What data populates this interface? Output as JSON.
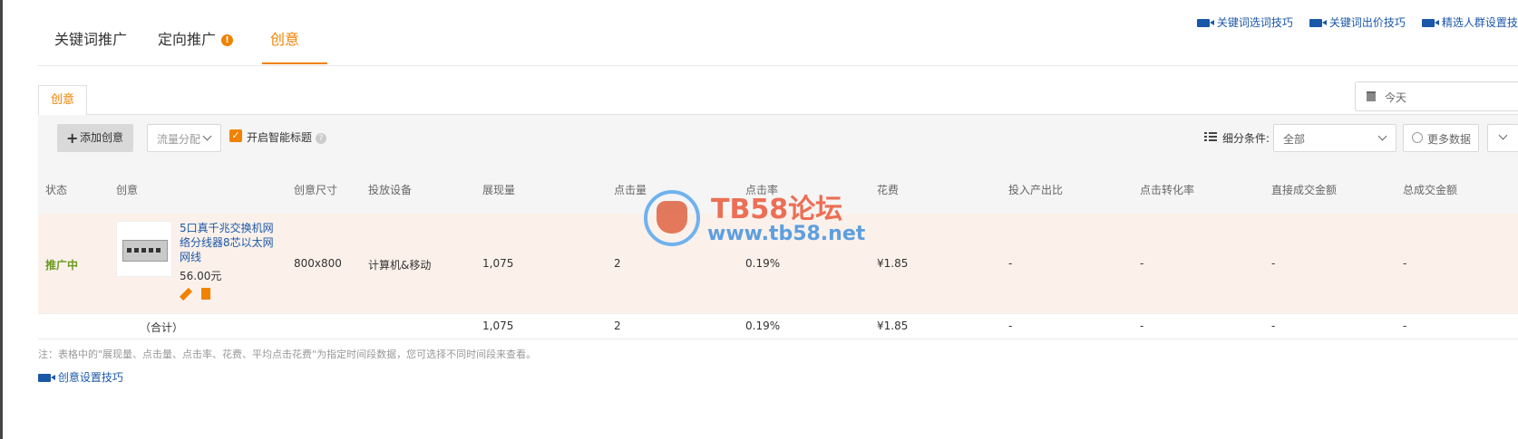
{
  "tabs": [
    {
      "label": "关键词推广"
    },
    {
      "label": "定向推广"
    },
    {
      "label": "创意"
    }
  ],
  "top_links": [
    "关键词选词技巧",
    "关键词出价技巧",
    "精选人群设置技"
  ],
  "subtab": "创意",
  "date_filter": "今天",
  "toolbar": {
    "add_label": "添加创意",
    "traffic_label": "流量分配",
    "smart_title_label": "开启智能标题",
    "segment_label": "细分条件:",
    "segment_value": "全部",
    "more_data_label": "更多数据"
  },
  "columns": [
    "状态",
    "创意",
    "创意尺寸",
    "投放设备",
    "展现量",
    "点击量",
    "点击率",
    "花费",
    "投入产出比",
    "点击转化率",
    "直接成交金额",
    "总成交金额"
  ],
  "row": {
    "status": "推广中",
    "title": "5口真千兆交换机网络分线器8芯以太网网线",
    "price": "56.00元",
    "size": "800x800",
    "device": "计算机&移动",
    "impressions": "1,075",
    "clicks": "2",
    "ctr": "0.19%",
    "cost": "¥1.85",
    "roi": "-",
    "cvr": "-",
    "direct_amount": "-",
    "total_amount": "-"
  },
  "total_row": {
    "label": "（合计）",
    "impressions": "1,075",
    "clicks": "2",
    "ctr": "0.19%",
    "cost": "¥1.85",
    "roi": "-",
    "cvr": "-",
    "direct_amount": "-",
    "total_amount": "-"
  },
  "note": "注：表格中的\"展现量、点击量、点击率、花费、平均点击花费\"为指定时间段数据，您可选择不同时间段来查看。",
  "bottom_link": "创意设置技巧",
  "watermark": {
    "line1": "TB58论坛",
    "line2": "www.tb58.net"
  },
  "colors": {
    "accent": "#f08200",
    "link": "#1b57a8",
    "status_green": "#6a9a1f",
    "row_bg": "#fbf1ea"
  }
}
